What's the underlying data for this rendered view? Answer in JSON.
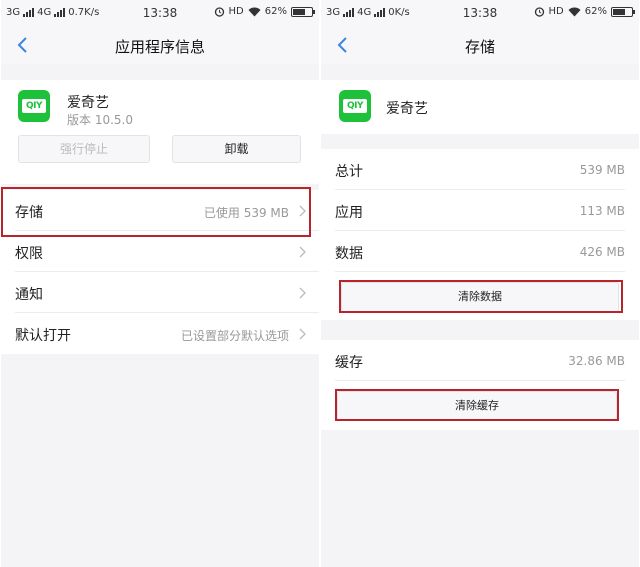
{
  "left": {
    "status": {
      "net": "3G",
      "net2": "4G",
      "speed": "0.7K/s",
      "time": "13:38",
      "hd": "HD",
      "battery": "62%"
    },
    "nav": {
      "title": "应用程序信息"
    },
    "app": {
      "name": "爱奇艺",
      "version": "版本 10.5.0",
      "icon_text": "QIY"
    },
    "buttons": {
      "force_stop": "强行停止",
      "uninstall": "卸载"
    },
    "rows": [
      {
        "label": "存储",
        "value": "已使用 539 MB"
      },
      {
        "label": "权限",
        "value": ""
      },
      {
        "label": "通知",
        "value": ""
      },
      {
        "label": "默认打开",
        "value": "已设置部分默认选项"
      }
    ]
  },
  "right": {
    "status": {
      "net": "3G",
      "net2": "4G",
      "speed": "0K/s",
      "time": "13:38",
      "hd": "HD",
      "battery": "62%"
    },
    "nav": {
      "title": "存储"
    },
    "app": {
      "name": "爱奇艺",
      "icon_text": "QIY"
    },
    "storage_rows": [
      {
        "label": "总计",
        "value": "539 MB"
      },
      {
        "label": "应用",
        "value": "113 MB"
      },
      {
        "label": "数据",
        "value": "426 MB"
      }
    ],
    "clear_data_label": "清除数据",
    "cache": {
      "label": "缓存",
      "value": "32.86 MB"
    },
    "clear_cache_label": "清除缓存"
  },
  "colors": {
    "highlight": "#b8242c",
    "app_green": "#1ec13a",
    "back_blue": "#3a86e8"
  },
  "icons": [
    "back-icon",
    "chevron-right-icon",
    "alarm-icon",
    "wifi-icon",
    "battery-icon",
    "signal-icon"
  ]
}
